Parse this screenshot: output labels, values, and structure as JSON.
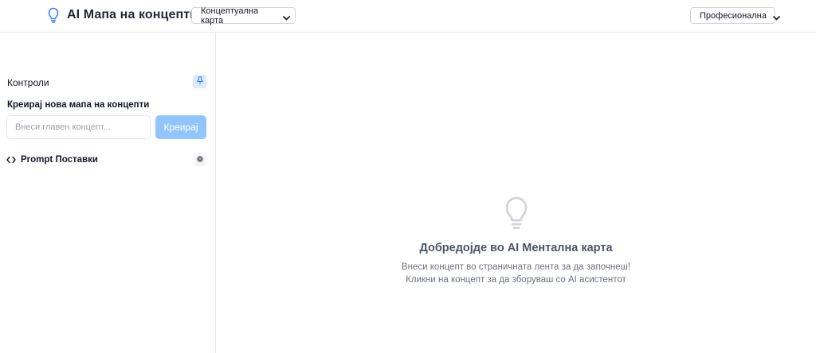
{
  "header": {
    "title": "AI Мапа на концепти",
    "brand_icon": "lightbulb-icon",
    "map_type_select": {
      "selected": "Концептуална карта"
    },
    "mode_select": {
      "selected": "Професионална"
    }
  },
  "sidebar": {
    "title": "Контроли",
    "pin_icon": "pin-icon",
    "create_section": {
      "label": "Креирај нова мапа на концепти",
      "input_placeholder": "Внеси главен концепт...",
      "input_value": "",
      "create_button": "Креирај"
    },
    "prompt_settings": {
      "label": "Prompt Поставки",
      "icon": "code-icon",
      "settings_icon": "gear-icon"
    }
  },
  "canvas": {
    "empty_icon": "lightbulb-icon",
    "title": "Добредојде во AI Ментална карта",
    "line1": "Внеси концепт во страничната лента за да започнеш!",
    "line2": "Кликни на концепт за да зборуваш со AI асистентот"
  },
  "colors": {
    "accent": "#3b82f6",
    "button_disabled": "#93c5fd",
    "icon_muted": "#d1d5db"
  }
}
